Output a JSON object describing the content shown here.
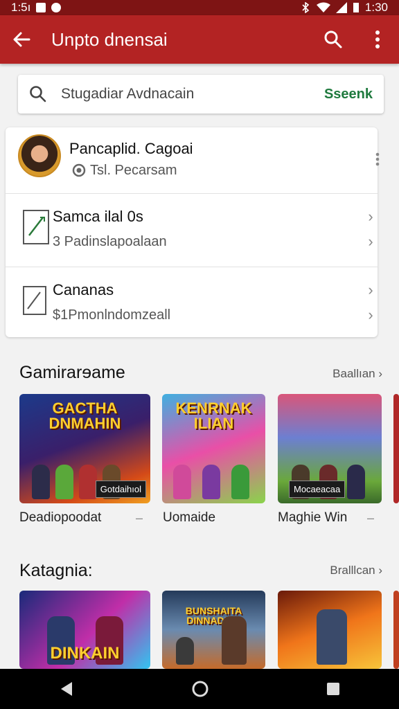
{
  "status_bar": {
    "time_left": "1:5ı",
    "time_right": "1:30"
  },
  "app_bar": {
    "title": "Unpto dnensai"
  },
  "search": {
    "placeholder": "Stugadiar Avdnacain",
    "action_label": "Sseenk"
  },
  "profile": {
    "name": "Pancaplid. Cagoai",
    "subtitle": "Tsl. Pecarsam"
  },
  "list": [
    {
      "title": "Samca ilal 0s",
      "subtitle": "3 Padinslapoalaan"
    },
    {
      "title": "Cananas",
      "subtitle": "$1Pmonlndomzeall"
    }
  ],
  "sections": [
    {
      "title": "Gamirarɘame",
      "link": "Baallıan",
      "tiles": [
        {
          "label": "Deadiopoodat",
          "thumb_text": "GACTHA DNMAHIN",
          "badge": "Gotdaihıol",
          "colors": [
            "#1c3a8a",
            "#d44a18",
            "#f0a020"
          ]
        },
        {
          "label": "Uomaide",
          "thumb_text": "KENRNAK ILIAN",
          "badge": "",
          "colors": [
            "#3fb0e0",
            "#e94fa7",
            "#8ad44b"
          ]
        },
        {
          "label": "Maghie Win",
          "thumb_text": "",
          "badge": "Mocaeacaa",
          "colors": [
            "#d9567a",
            "#6c7fd1",
            "#6aa83a"
          ]
        }
      ]
    },
    {
      "title": "Katagnia:",
      "link": "Bralllcan",
      "tiles": [
        {
          "label": "",
          "thumb_text": "DINKAIN",
          "badge": "",
          "colors": [
            "#1a2a7a",
            "#c02ea8",
            "#32c4f0"
          ]
        },
        {
          "label": "",
          "thumb_text": "BUNSHAITA DINNADIAN",
          "badge": "",
          "colors": [
            "#243a5a",
            "#6a8bb0",
            "#c56b2a"
          ]
        },
        {
          "label": "",
          "thumb_text": "",
          "badge": "",
          "colors": [
            "#6a1a0a",
            "#f0751a",
            "#f7c43a"
          ]
        }
      ]
    }
  ],
  "colors": {
    "app_bar": "#b32323",
    "status_bar": "#7e1414",
    "search_action": "#1f7a3e"
  }
}
